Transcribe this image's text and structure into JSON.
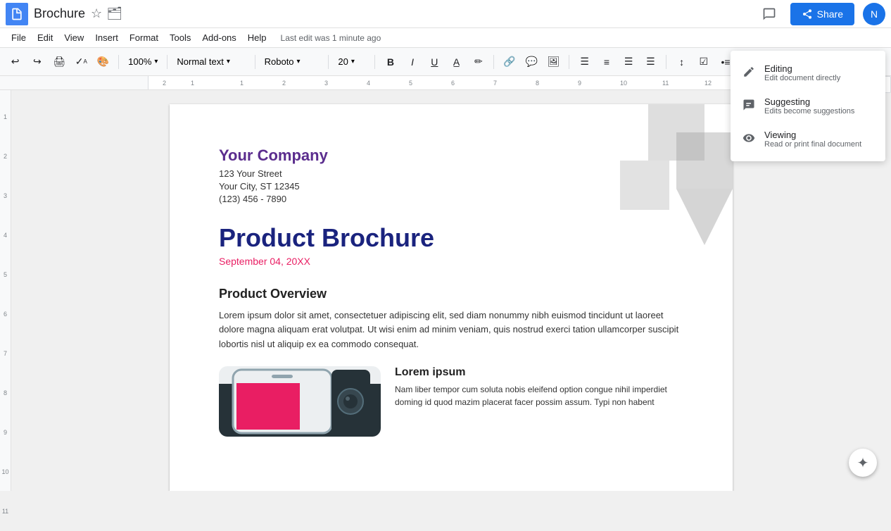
{
  "header": {
    "doc_title": "Brochure",
    "last_edit": "Last edit was 1 minute ago",
    "share_label": "Share",
    "avatar_letter": "N"
  },
  "menubar": {
    "items": [
      "File",
      "Edit",
      "View",
      "Insert",
      "Format",
      "Tools",
      "Add-ons",
      "Help"
    ]
  },
  "toolbar": {
    "paragraph_style": "Normal text",
    "font_family": "Roboto",
    "font_size": "20",
    "zoom": "100%"
  },
  "mode_dropdown": {
    "editing": {
      "title": "Editing",
      "subtitle": "Edit document directly"
    },
    "suggesting": {
      "title": "Suggesting",
      "subtitle": "Edits become suggestions"
    },
    "viewing": {
      "title": "Viewing",
      "subtitle": "Read or print final document"
    }
  },
  "document": {
    "company_name": "Your Company",
    "address1": "123 Your Street",
    "address2": "Your City, ST 12345",
    "phone": "(123) 456 - 7890",
    "product_title": "Product Brochure",
    "date": "September 04, 20XX",
    "overview_heading": "Product Overview",
    "overview_body": "Lorem ipsum dolor sit amet, consectetuer adipiscing elit, sed diam nonummy nibh euismod tincidunt ut laoreet dolore magna aliquam erat volutpat. Ut wisi enim ad minim veniam, quis nostrud exerci tation ullamcorper suscipit lobortis nisl ut aliquip ex ea commodo consequat.",
    "lorem_heading": "Lorem ipsum",
    "lorem_body": "Nam liber tempor cum soluta nobis eleifend option congue nihil imperdiet doming id quod mazim placerat facer possim assum. Typi non habent"
  }
}
